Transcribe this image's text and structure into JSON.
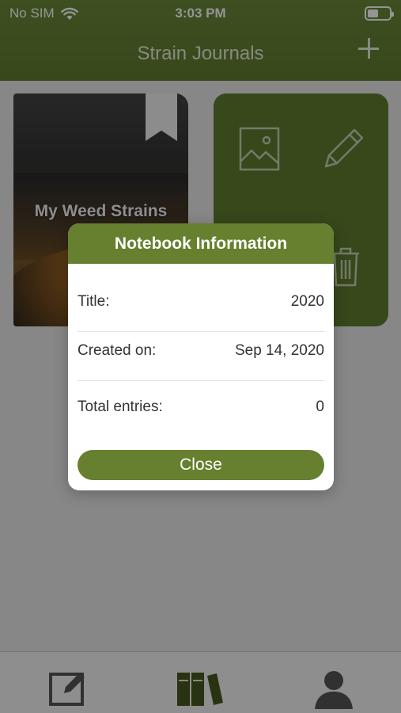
{
  "status_bar": {
    "carrier": "No SIM",
    "time": "3:03 PM",
    "wifi_icon": "wifi-icon",
    "battery_icon": "battery-icon"
  },
  "nav_bar": {
    "title": "Strain Journals",
    "add_icon": "plus-icon"
  },
  "notebooks": [
    {
      "title": "My Weed Strains",
      "bookmark_icon": "bookmark-icon"
    }
  ],
  "notebook_actions": {
    "icons": [
      "image-icon",
      "pencil-icon",
      "trash-icon"
    ]
  },
  "modal": {
    "title": "Notebook Information",
    "rows": [
      {
        "label": "Title:",
        "value": "2020"
      },
      {
        "label": "Created on:",
        "value": "Sep 14, 2020"
      },
      {
        "label": "Total entries:",
        "value": "0"
      }
    ],
    "close_label": "Close"
  },
  "tab_bar": {
    "items": [
      {
        "icon": "compose-icon"
      },
      {
        "icon": "books-icon",
        "selected": true
      },
      {
        "icon": "profile-icon"
      }
    ]
  },
  "colors": {
    "accent": "#66802f",
    "nav_bar": "#5f7c2f",
    "overlay": "rgba(0,0,0,0.42)"
  }
}
